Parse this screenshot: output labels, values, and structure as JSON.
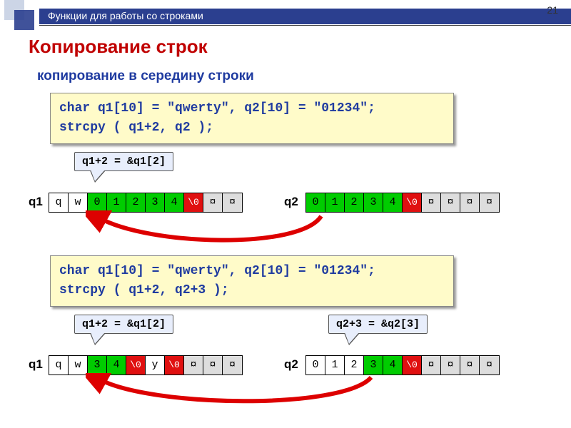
{
  "header": {
    "title": "Функции для работы со строками",
    "page": "21"
  },
  "title": "Копирование строк",
  "subtitle": "копирование в середину строки",
  "code1": {
    "line1": "char q1[10] = \"qwerty\", q2[10] = \"01234\";",
    "line2": "strcpy ( q1+2, q2 );"
  },
  "code2": {
    "line1": "char q1[10] = \"qwerty\", q2[10] = \"01234\";",
    "line2": "strcpy ( q1+2, q2+3 );"
  },
  "bubble1": "q1+2 = &q1[2]",
  "bubble2": "q1+2 = &q1[2]",
  "bubble3": "q2+3 = &q2[3]",
  "labels": {
    "q1": "q1",
    "q2": "q2"
  },
  "row1q1": [
    "q",
    "w",
    "0",
    "1",
    "2",
    "3",
    "4",
    "\\0",
    "¤",
    "¤"
  ],
  "row1q2": [
    "0",
    "1",
    "2",
    "3",
    "4",
    "\\0",
    "¤",
    "¤",
    "¤",
    "¤"
  ],
  "row2q1": [
    "q",
    "w",
    "3",
    "4",
    "\\0",
    "y",
    "\\0",
    "¤",
    "¤",
    "¤"
  ],
  "row2q2": [
    "0",
    "1",
    "2",
    "3",
    "4",
    "\\0",
    "¤",
    "¤",
    "¤",
    "¤"
  ],
  "colors": {
    "row1q1": [
      "c-white",
      "c-white",
      "c-green",
      "c-green",
      "c-green",
      "c-green",
      "c-green",
      "c-red",
      "c-gray",
      "c-gray"
    ],
    "row1q2": [
      "c-green",
      "c-green",
      "c-green",
      "c-green",
      "c-green",
      "c-red",
      "c-gray",
      "c-gray",
      "c-gray",
      "c-gray"
    ],
    "row2q1": [
      "c-white",
      "c-white",
      "c-green",
      "c-green",
      "c-red",
      "c-white",
      "c-red",
      "c-gray",
      "c-gray",
      "c-gray"
    ],
    "row2q2": [
      "c-white",
      "c-white",
      "c-white",
      "c-green",
      "c-green",
      "c-red",
      "c-gray",
      "c-gray",
      "c-gray",
      "c-gray"
    ]
  }
}
